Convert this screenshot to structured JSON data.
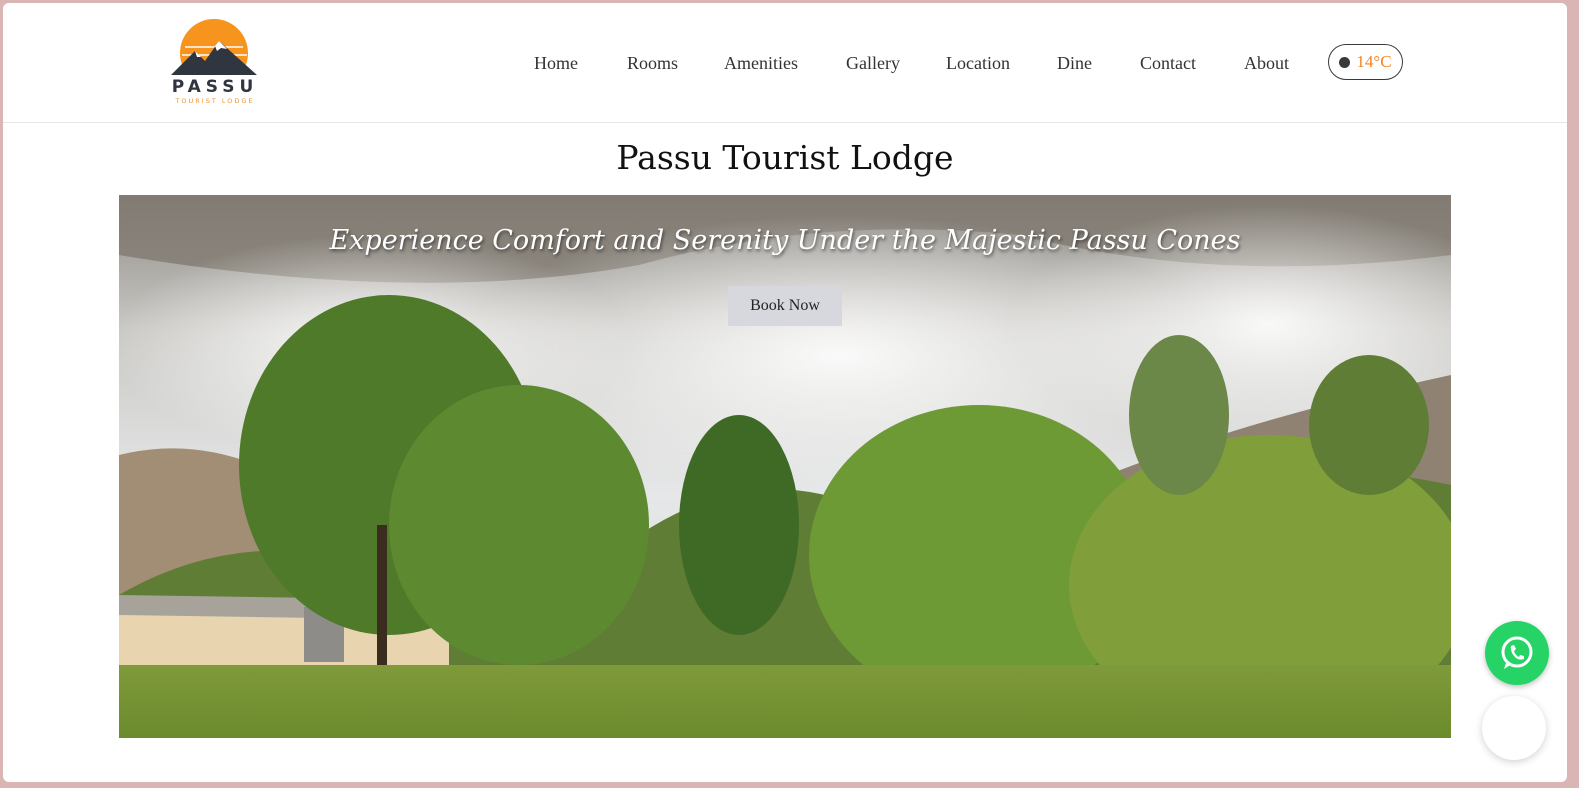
{
  "brand": {
    "name": "PASSU",
    "subtitle": "TOURIST LODGE",
    "accent": "#f5821f"
  },
  "nav": {
    "items": [
      {
        "label": "Home"
      },
      {
        "label": "Rooms"
      },
      {
        "label": "Amenities"
      },
      {
        "label": "Gallery"
      },
      {
        "label": "Location"
      },
      {
        "label": "Dine"
      },
      {
        "label": "Contact"
      },
      {
        "label": "About"
      }
    ]
  },
  "weather": {
    "temperature": "14°C",
    "icon": "theme-toggle-dot-icon"
  },
  "page": {
    "title": "Passu Tourist Lodge"
  },
  "hero": {
    "tagline": "Experience Comfort and Serenity Under the Majestic Passu Cones",
    "cta_label": "Book Now"
  },
  "widgets": {
    "whatsapp_icon": "whatsapp-icon",
    "whatsapp_color": "#25d366"
  }
}
